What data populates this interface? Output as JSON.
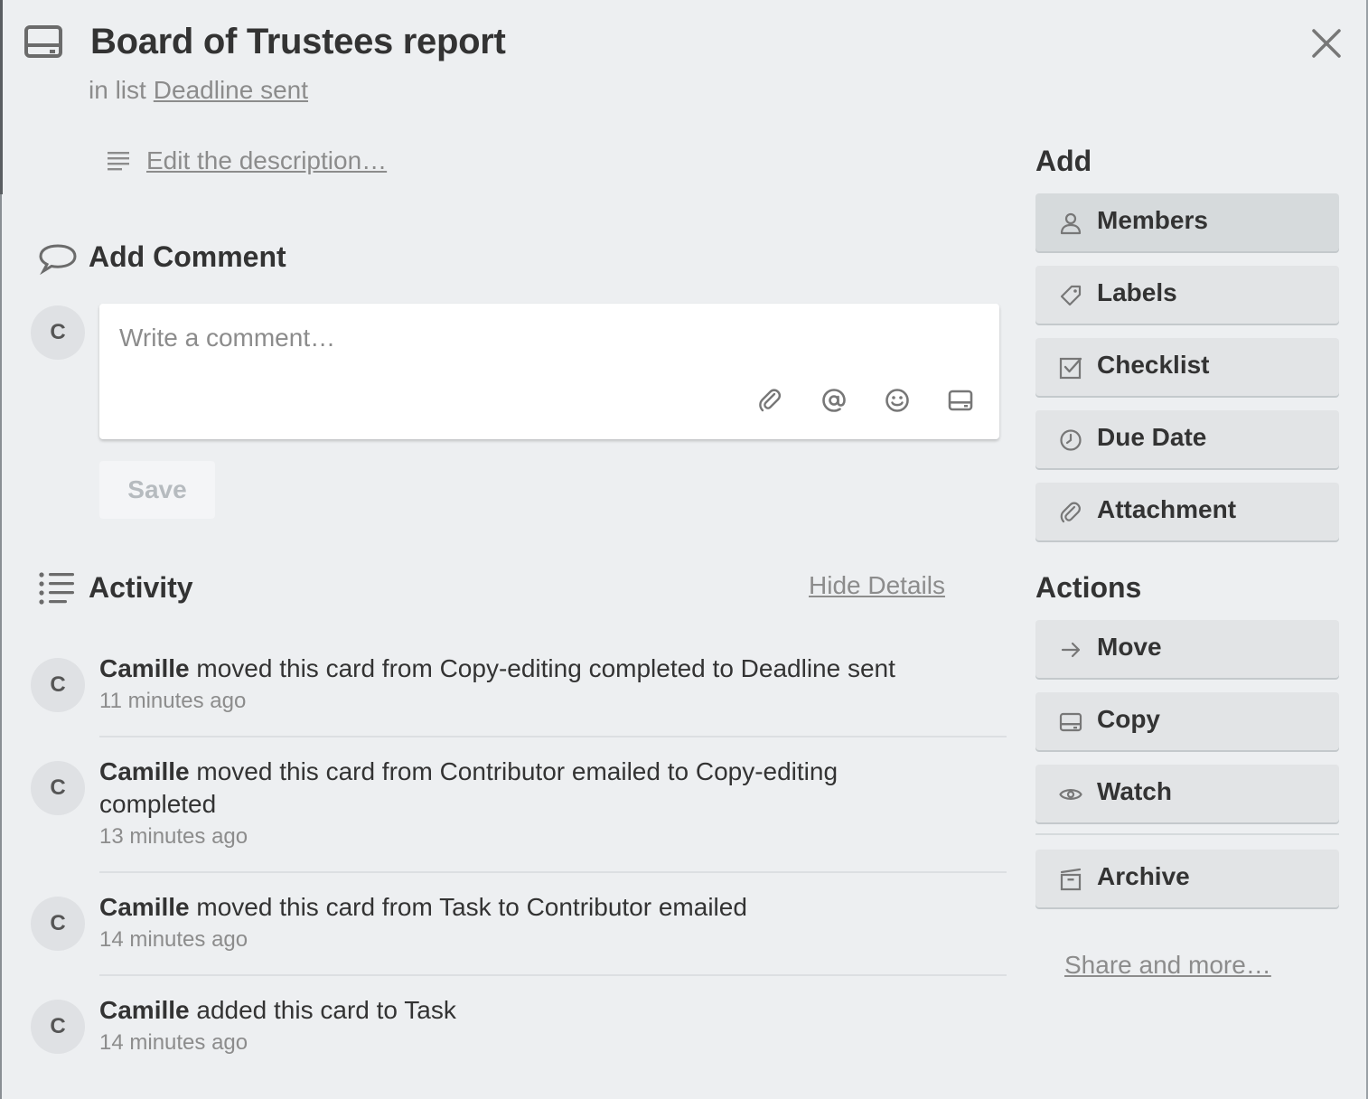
{
  "card": {
    "title": "Board of Trustees report",
    "in_list_prefix": "in list",
    "list_name": "Deadline sent",
    "description_link": "Edit the description…"
  },
  "comment": {
    "heading": "Add Comment",
    "avatar_initial": "C",
    "placeholder": "Write a comment…",
    "save_label": "Save",
    "tools": [
      "attachment-icon",
      "mention-icon",
      "emoji-icon",
      "card-icon"
    ]
  },
  "activity": {
    "heading": "Activity",
    "hide_details": "Hide Details",
    "items": [
      {
        "avatar": "C",
        "user": "Camille",
        "text": "moved this card from Copy-editing completed to Deadline sent",
        "time": "11 minutes ago"
      },
      {
        "avatar": "C",
        "user": "Camille",
        "text": "moved this card from Contributor emailed to Copy-editing completed",
        "time": "13 minutes ago"
      },
      {
        "avatar": "C",
        "user": "Camille",
        "text": "moved this card from Task to Contributor emailed",
        "time": "14 minutes ago"
      },
      {
        "avatar": "C",
        "user": "Camille",
        "text": "added this card to Task",
        "time": "14 minutes ago"
      }
    ]
  },
  "sidebar": {
    "add_heading": "Add",
    "add_buttons": [
      {
        "label": "Members",
        "icon": "person-icon"
      },
      {
        "label": "Labels",
        "icon": "tag-icon"
      },
      {
        "label": "Checklist",
        "icon": "checkbox-icon"
      },
      {
        "label": "Due Date",
        "icon": "clock-icon"
      },
      {
        "label": "Attachment",
        "icon": "paperclip-icon"
      }
    ],
    "actions_heading": "Actions",
    "action_buttons": [
      {
        "label": "Move",
        "icon": "arrow-right-icon"
      },
      {
        "label": "Copy",
        "icon": "card-icon"
      },
      {
        "label": "Watch",
        "icon": "eye-icon"
      },
      {
        "label": "Archive",
        "icon": "archive-icon"
      }
    ],
    "share_link": "Share and more…"
  }
}
